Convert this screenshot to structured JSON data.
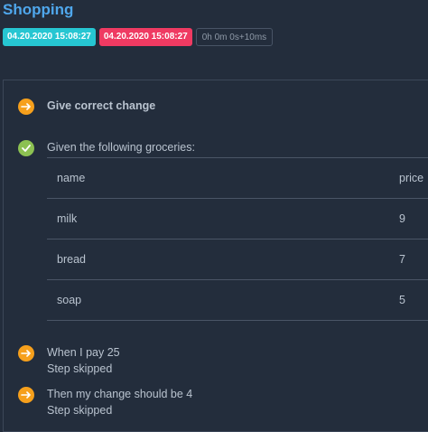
{
  "title": "Shopping",
  "badges": {
    "start": "04.20.2020 15:08:27",
    "end": "04.20.2020 15:08:27",
    "duration": "0h 0m 0s+10ms"
  },
  "colors": {
    "title": "#4fa7ec",
    "start_badge": "#26c6d2",
    "end_badge": "#ef3a62",
    "pending": "#f6a01c",
    "passed": "#8cc152",
    "background": "#232d3c"
  },
  "steps": [
    {
      "text": "Give correct change",
      "icon": "arrow-right-icon",
      "status": "pending"
    },
    {
      "text": "Given the following groceries:",
      "icon": "check-icon",
      "status": "passed"
    },
    {
      "text": "When I pay 25",
      "sub": "Step skipped",
      "icon": "arrow-right-icon",
      "status": "skipped"
    },
    {
      "text": "Then my change should be 4",
      "sub": "Step skipped",
      "icon": "arrow-right-icon",
      "status": "skipped"
    }
  ],
  "table": {
    "headers": {
      "name": "name",
      "price": "price"
    },
    "rows": [
      {
        "name": "milk",
        "price": "9"
      },
      {
        "name": "bread",
        "price": "7"
      },
      {
        "name": "soap",
        "price": "5"
      }
    ]
  }
}
